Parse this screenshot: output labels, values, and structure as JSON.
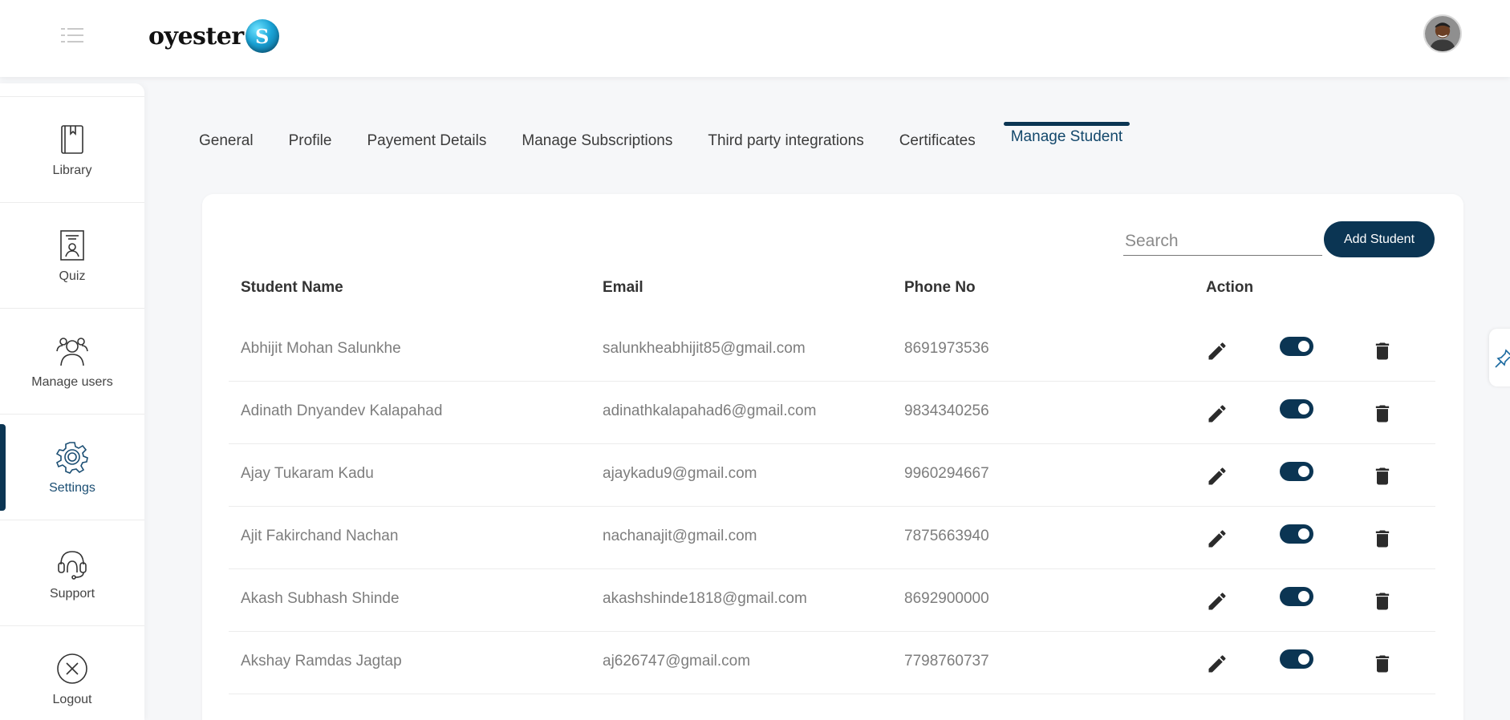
{
  "app": {
    "logo_text": "oyester",
    "logo_badge": "S"
  },
  "sidebar": {
    "items": [
      {
        "label": "Library",
        "icon": "book-icon"
      },
      {
        "label": "Quiz",
        "icon": "quiz-icon"
      },
      {
        "label": "Manage users",
        "icon": "users-icon"
      },
      {
        "label": "Settings",
        "icon": "gear-icon",
        "active": true
      },
      {
        "label": "Support",
        "icon": "headset-icon"
      },
      {
        "label": "Logout",
        "icon": "close-circle-icon"
      }
    ]
  },
  "tabs": [
    {
      "label": "General"
    },
    {
      "label": "Profile"
    },
    {
      "label": "Payement Details"
    },
    {
      "label": "Manage Subscriptions"
    },
    {
      "label": "Third party integrations"
    },
    {
      "label": "Certificates"
    },
    {
      "label": "Manage Student",
      "active": true
    }
  ],
  "toolbar": {
    "search_placeholder": "Search",
    "add_label": "Add Student"
  },
  "table": {
    "headers": {
      "name": "Student Name",
      "email": "Email",
      "phone": "Phone No",
      "action": "Action"
    },
    "rows": [
      {
        "name": "Abhijit Mohan Salunkhe",
        "email": "salunkheabhijit85@gmail.com",
        "phone": "8691973536",
        "enabled": true
      },
      {
        "name": "Adinath Dnyandev Kalapahad",
        "email": "adinathkalapahad6@gmail.com",
        "phone": "9834340256",
        "enabled": true
      },
      {
        "name": "Ajay Tukaram Kadu",
        "email": "ajaykadu9@gmail.com",
        "phone": "9960294667",
        "enabled": true
      },
      {
        "name": "Ajit Fakirchand Nachan",
        "email": "nachanajit@gmail.com",
        "phone": "7875663940",
        "enabled": true
      },
      {
        "name": "Akash Subhash Shinde",
        "email": "akashshinde1818@gmail.com",
        "phone": "8692900000",
        "enabled": true
      },
      {
        "name": "Akshay Ramdas Jagtap",
        "email": "aj626747@gmail.com",
        "phone": "7798760737",
        "enabled": true
      }
    ]
  },
  "colors": {
    "primary": "#0b3553",
    "active_text": "#12476b",
    "muted_text": "#7d7d7d"
  }
}
